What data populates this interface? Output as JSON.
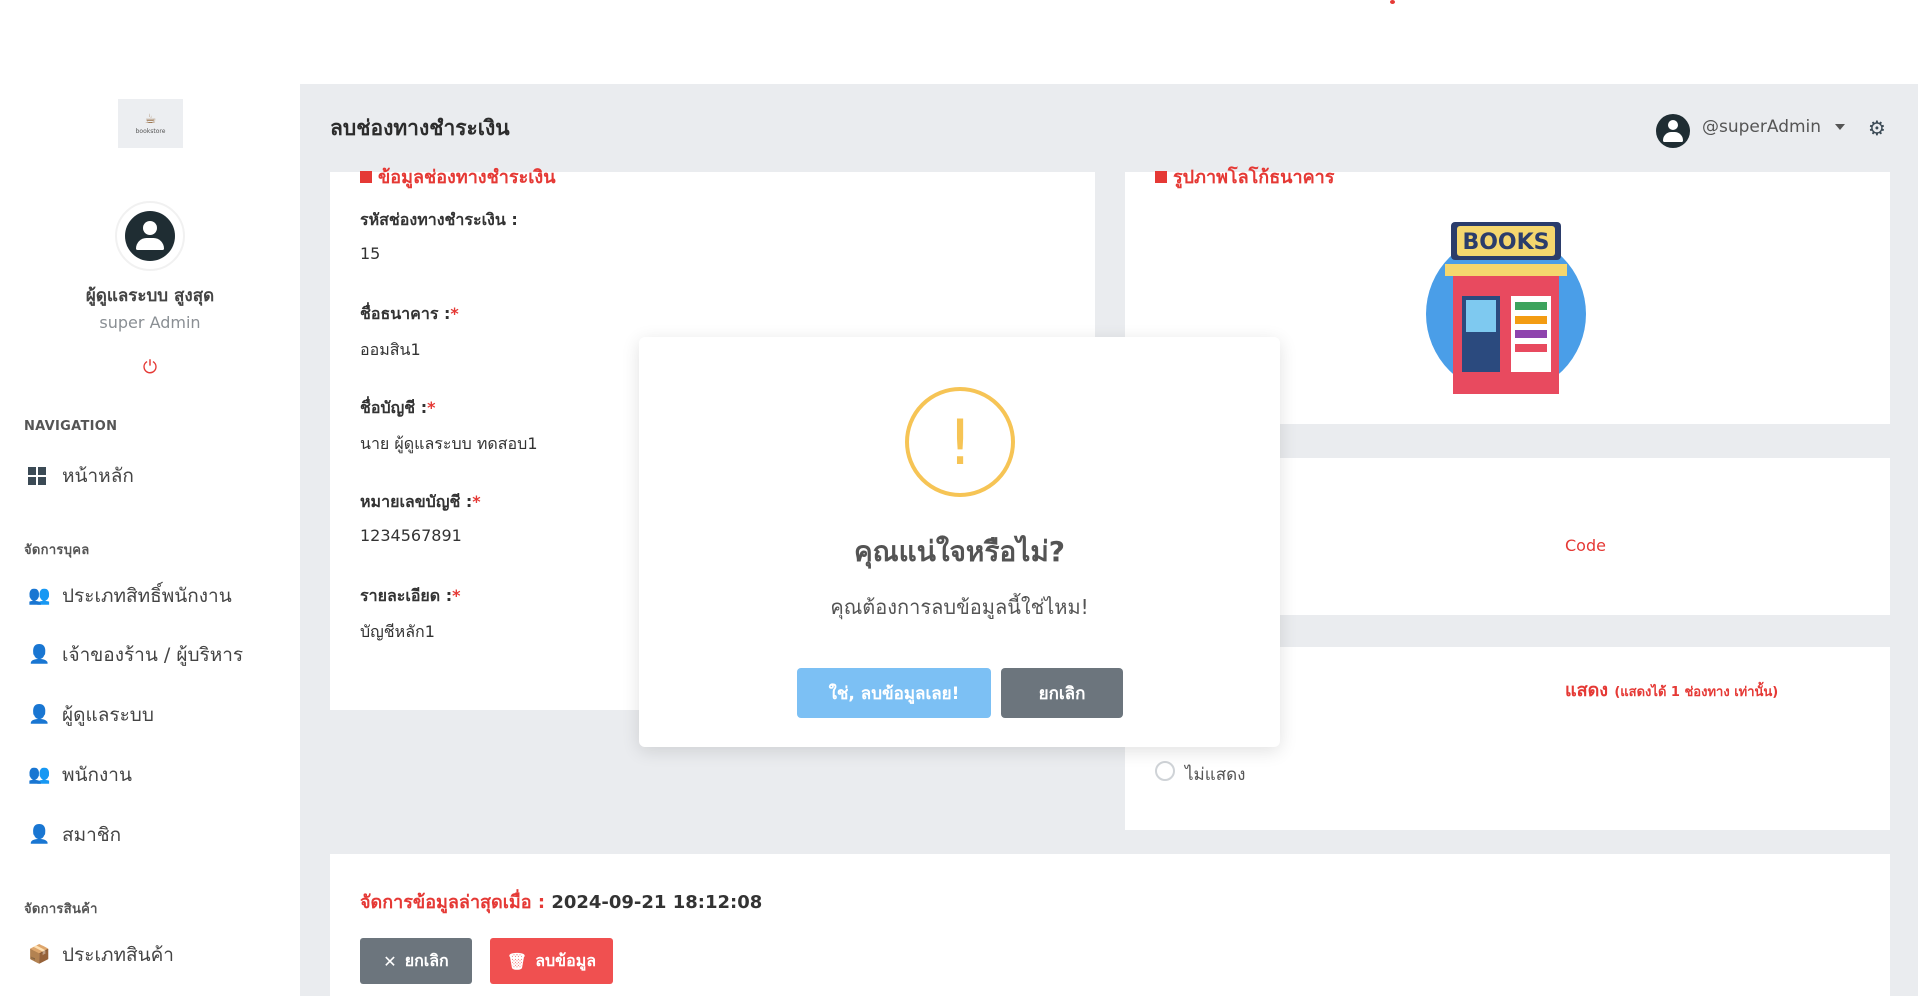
{
  "colors": {
    "accent_red": "#e53935",
    "dark": "#1f2d33",
    "warning": "#f6c455",
    "confirm_button": "#7cc0f4",
    "secondary_button": "#6c757d",
    "danger_button": "#f05050",
    "main_bg": "#eaecef"
  },
  "sidebar": {
    "logo_text": "bookstore",
    "user_name": "ผู้ดูแลระบบ สูงสุด",
    "user_role": "super Admin",
    "sections": {
      "navigation": "NAVIGATION",
      "personnel": "จัดการบุคล",
      "products": "จัดการสินค้า"
    },
    "items": [
      {
        "label": "หน้าหลัก",
        "icon": "dashboard-icon"
      },
      {
        "label": "ประเภทสิทธิ์พนักงาน",
        "icon": "users-cog-icon"
      },
      {
        "label": "เจ้าของร้าน / ผู้บริหาร",
        "icon": "user-tie-icon"
      },
      {
        "label": "ผู้ดูแลระบบ",
        "icon": "user-shield-icon"
      },
      {
        "label": "พนักงาน",
        "icon": "users-icon"
      },
      {
        "label": "สมาชิก",
        "icon": "user-icon"
      },
      {
        "label": "ประเภทสินค้า",
        "icon": "boxes-icon"
      }
    ]
  },
  "header": {
    "title": "ลบช่องทางชำระเงิน",
    "username": "@superAdmin"
  },
  "form": {
    "section_title": "ข้อมูลช่องทางชำระเงิน",
    "fields": [
      {
        "label": "รหัสช่องทางชำระเงิน :",
        "required": "",
        "value": "15"
      },
      {
        "label": "ชื่อธนาคาร :",
        "required": "*",
        "value": "ออมสิน1"
      },
      {
        "label": "ชื่อบัญชี :",
        "required": "*",
        "value": "นาย ผู้ดูแลระบบ ทดสอบ1"
      },
      {
        "label": "หมายเลขบัญชี :",
        "required": "*",
        "value": "1234567891"
      },
      {
        "label": "รายละเอียด :",
        "required": "*",
        "value": "บัญชีหลัก1"
      }
    ]
  },
  "image_card": {
    "title": "รูปภาพโลโก้ธนาคาร",
    "sign_text": "BOOKS"
  },
  "qr_card": {
    "partial_text": "Code"
  },
  "display_card": {
    "title_partial": "แสดง",
    "note": "(แสดงได้ 1 ช่องทาง เท่านั้น)",
    "radio_label": "ไม่แสดง"
  },
  "bottom": {
    "updated_label": "จัดการข้อมูลล่าสุดเมื่อ :",
    "updated_value": "2024-09-21 18:12:08",
    "cancel_label": "ยกเลิก",
    "delete_label": "ลบข้อมูล"
  },
  "modal": {
    "icon": "!",
    "title": "คุณแน่ใจหรือไม่?",
    "text": "คุณต้องการลบข้อมูลนี้ใช่ไหม!",
    "confirm_label": "ใช่, ลบข้อมูลเลย!",
    "cancel_label": "ยกเลิก"
  }
}
